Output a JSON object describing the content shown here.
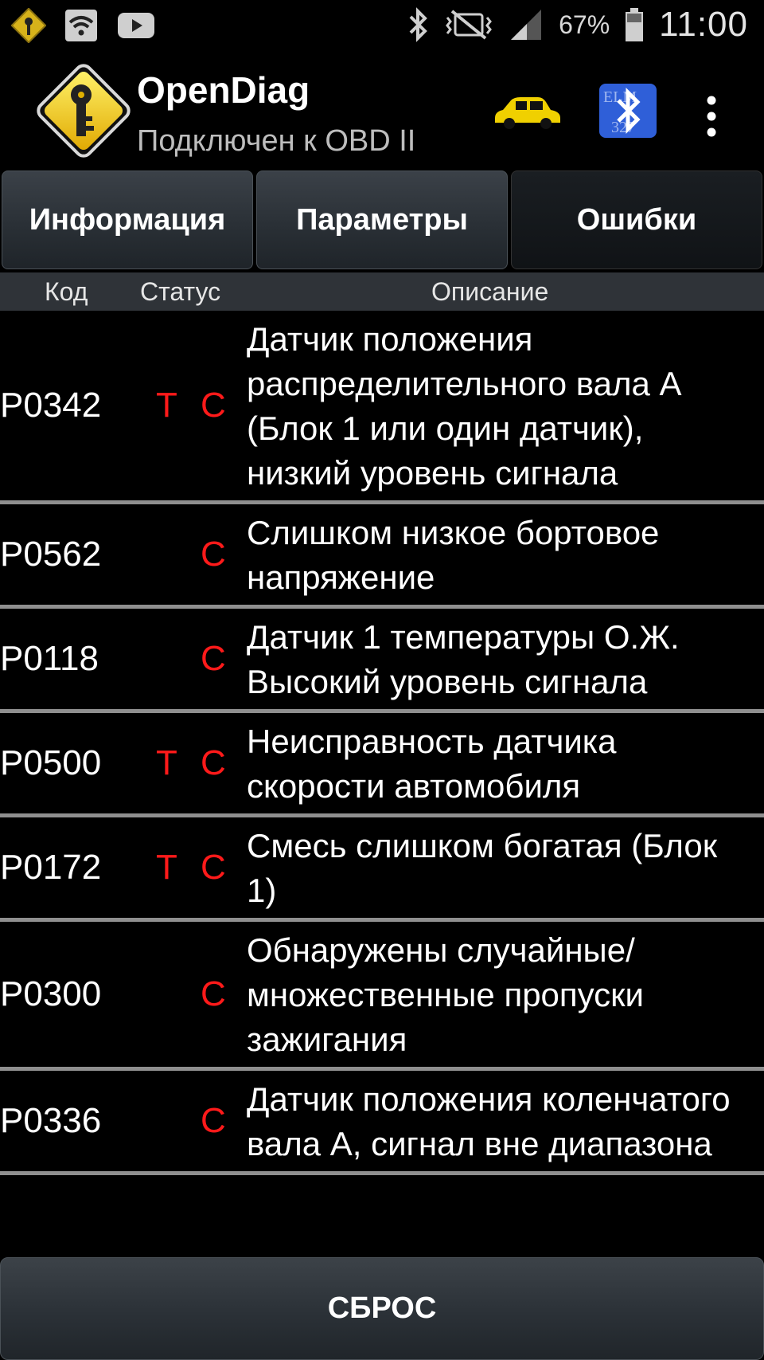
{
  "status_bar": {
    "battery_percent": "67%",
    "time": "11:00",
    "icons": [
      "app-key-icon",
      "wifi-icon",
      "youtube-icon",
      "bluetooth-icon",
      "vibrate-icon",
      "signal-icon",
      "battery-icon"
    ]
  },
  "header": {
    "title": "OpenDiag",
    "subtitle": "Подключен к OBD II",
    "colors": {
      "car": "#f0d000",
      "bluetooth_bg": "#2f5fd8"
    }
  },
  "tabs": [
    {
      "label": "Информация",
      "active": false
    },
    {
      "label": "Параметры",
      "active": false
    },
    {
      "label": "Ошибки",
      "active": true
    }
  ],
  "table": {
    "headers": {
      "code": "Код",
      "status": "Статус",
      "description": "Описание"
    },
    "rows": [
      {
        "code": "P0342",
        "t": "T",
        "c": "C",
        "description": "Датчик положения распределительного вала A (Блок 1 или один датчик), низкий уровень сигнала"
      },
      {
        "code": "P0562",
        "t": "",
        "c": "C",
        "description": "Слишком низкое бортовое напряжение"
      },
      {
        "code": "P0118",
        "t": "",
        "c": "C",
        "description": "Датчик 1 температуры О.Ж. Высокий уровень сигнала"
      },
      {
        "code": "P0500",
        "t": "T",
        "c": "C",
        "description": "Неисправность датчика скорости автомобиля"
      },
      {
        "code": "P0172",
        "t": "T",
        "c": "C",
        "description": "Смесь слишком богатая (Блок 1)"
      },
      {
        "code": "P0300",
        "t": "",
        "c": "C",
        "description": "Обнаружены случайные/ множественные пропуски зажигания"
      },
      {
        "code": "P0336",
        "t": "",
        "c": "C",
        "description": "Датчик положения коленчатого вала A, сигнал вне диапазона"
      }
    ],
    "status_color": "#ff1a1a"
  },
  "reset_button": {
    "label": "СБРОС"
  }
}
